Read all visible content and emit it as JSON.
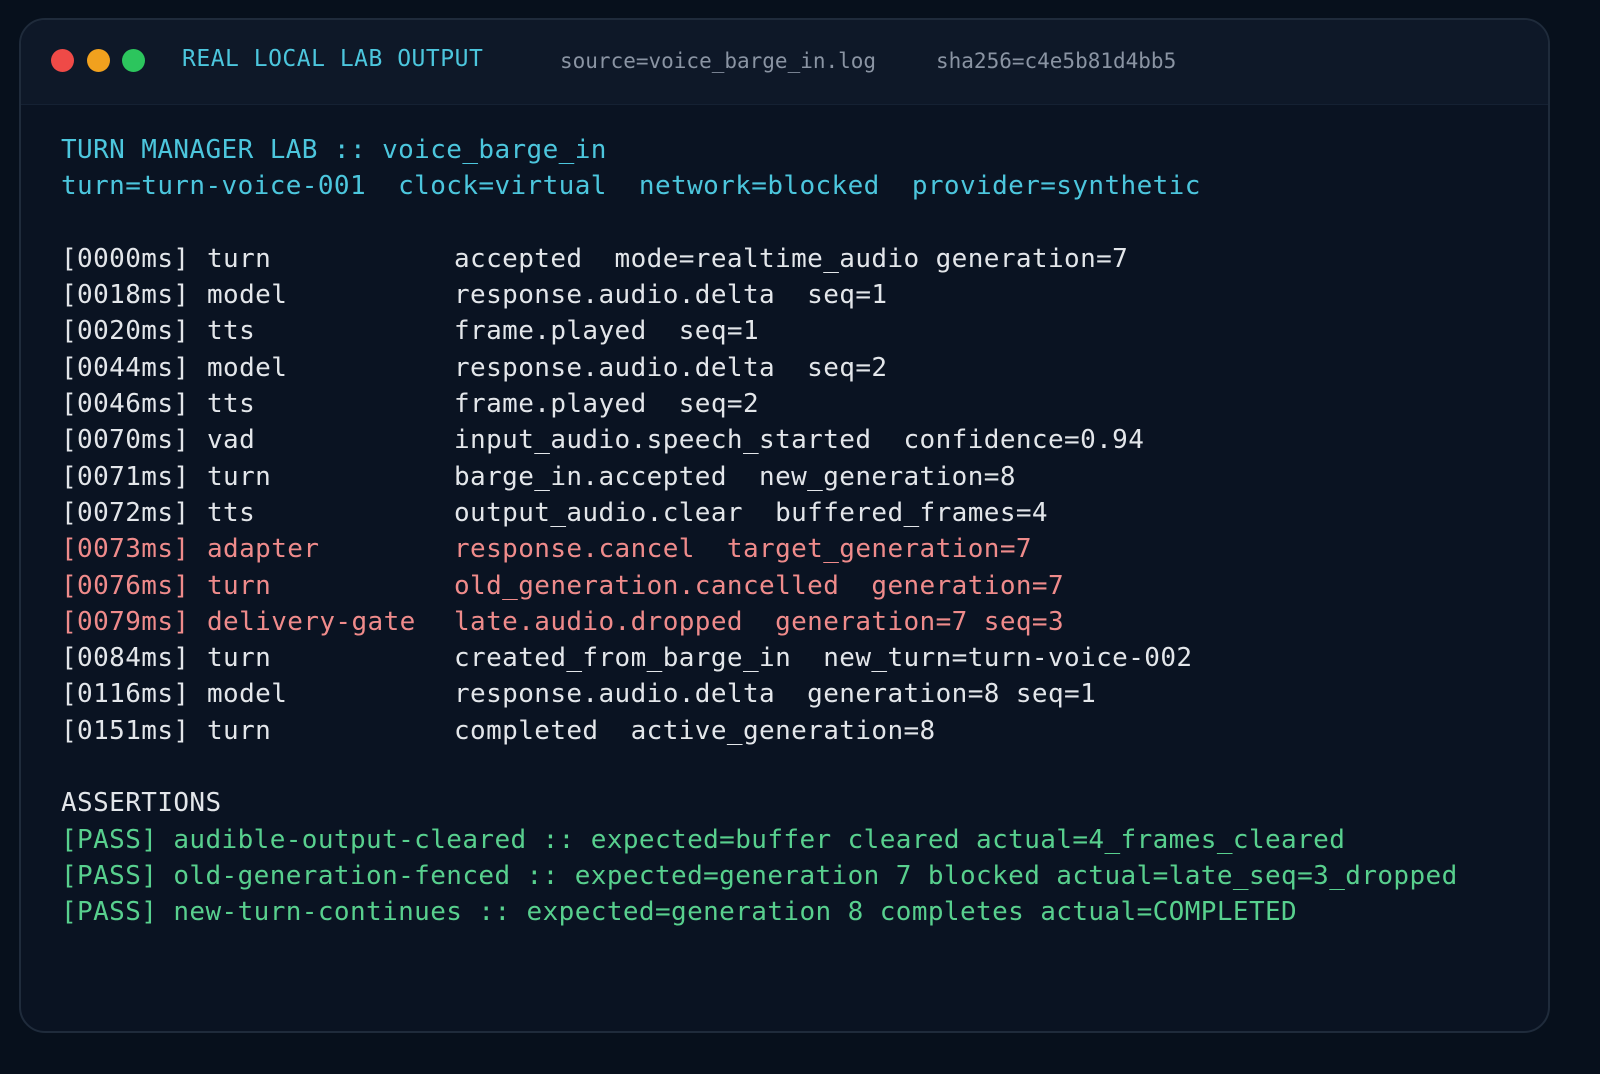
{
  "titlebar": {
    "title": "REAL LOCAL LAB OUTPUT",
    "source": "source=voice_barge_in.log",
    "sha": "sha256=c4e5b81d4bb5"
  },
  "header": {
    "line1": "TURN MANAGER LAB :: voice_barge_in",
    "line2": "turn=turn-voice-001  clock=virtual  network=blocked  provider=synthetic"
  },
  "log": [
    {
      "ts": "[0000ms]",
      "comp": "turn",
      "msg": "accepted  mode=realtime_audio generation=7",
      "highlight": false
    },
    {
      "ts": "[0018ms]",
      "comp": "model",
      "msg": "response.audio.delta  seq=1",
      "highlight": false
    },
    {
      "ts": "[0020ms]",
      "comp": "tts",
      "msg": "frame.played  seq=1",
      "highlight": false
    },
    {
      "ts": "[0044ms]",
      "comp": "model",
      "msg": "response.audio.delta  seq=2",
      "highlight": false
    },
    {
      "ts": "[0046ms]",
      "comp": "tts",
      "msg": "frame.played  seq=2",
      "highlight": false
    },
    {
      "ts": "[0070ms]",
      "comp": "vad",
      "msg": "input_audio.speech_started  confidence=0.94",
      "highlight": false
    },
    {
      "ts": "[0071ms]",
      "comp": "turn",
      "msg": "barge_in.accepted  new_generation=8",
      "highlight": false
    },
    {
      "ts": "[0072ms]",
      "comp": "tts",
      "msg": "output_audio.clear  buffered_frames=4",
      "highlight": false
    },
    {
      "ts": "[0073ms]",
      "comp": "adapter",
      "msg": "response.cancel  target_generation=7",
      "highlight": true
    },
    {
      "ts": "[0076ms]",
      "comp": "turn",
      "msg": "old_generation.cancelled  generation=7",
      "highlight": true
    },
    {
      "ts": "[0079ms]",
      "comp": "delivery-gate",
      "msg": "late.audio.dropped  generation=7 seq=3",
      "highlight": true
    },
    {
      "ts": "[0084ms]",
      "comp": "turn",
      "msg": "created_from_barge_in  new_turn=turn-voice-002",
      "highlight": false
    },
    {
      "ts": "[0116ms]",
      "comp": "model",
      "msg": "response.audio.delta  generation=8 seq=1",
      "highlight": false
    },
    {
      "ts": "[0151ms]",
      "comp": "turn",
      "msg": "completed  active_generation=8",
      "highlight": false
    }
  ],
  "assertions": {
    "title": "ASSERTIONS",
    "items": [
      "[PASS] audible-output-cleared :: expected=buffer cleared actual=4_frames_cleared",
      "[PASS] old-generation-fenced :: expected=generation 7 blocked actual=late_seq=3_dropped",
      "[PASS] new-turn-continues :: expected=generation 8 completes actual=COMPLETED"
    ]
  },
  "colors": {
    "header": "#4cc6dd",
    "text": "#e3e6ea",
    "warn": "#ef8b8b",
    "pass": "#58d08e"
  }
}
